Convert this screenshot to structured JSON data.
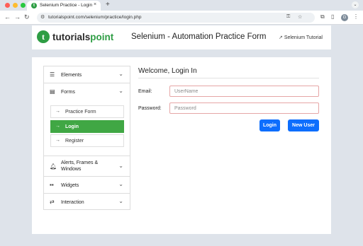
{
  "browser": {
    "tab_title": "Selenium Practice - Login",
    "tab_close": "×",
    "new_tab": "+",
    "url": "tutorialspoint.com/selenium/practice/login.php",
    "profile_initial": "G"
  },
  "header": {
    "logo_mark": "t",
    "logo_text_main": "tutorials",
    "logo_text_accent": "point",
    "title": "Selenium - Automation Practice Form",
    "tutorial_link": "Selenium Tutorial"
  },
  "sidebar": {
    "elements": "Elements",
    "forms": "Forms",
    "sub_items": [
      "Practice Form",
      "Login",
      "Register"
    ],
    "alerts": "Alerts, Frames & Windows",
    "widgets": "Widgets",
    "interaction": "Interaction"
  },
  "form": {
    "title": "Welcome, Login In",
    "email_label": "Email:",
    "email_placeholder": "UserName",
    "password_label": "Password:",
    "password_placeholder": "Password",
    "login_button": "Login",
    "new_user_button": "New User"
  },
  "colors": {
    "brand_green": "#2e9d44",
    "active_item": "#40a744",
    "primary_button": "#0d6efd",
    "input_border": "#e6a6a6"
  },
  "icons": {
    "elements": "hamburger-icon",
    "forms": "form-card-icon",
    "alerts": "bell-icon",
    "widgets": "grid-icon",
    "interaction": "swap-arrows-icon",
    "sub_item": "arrow-right-icon"
  }
}
